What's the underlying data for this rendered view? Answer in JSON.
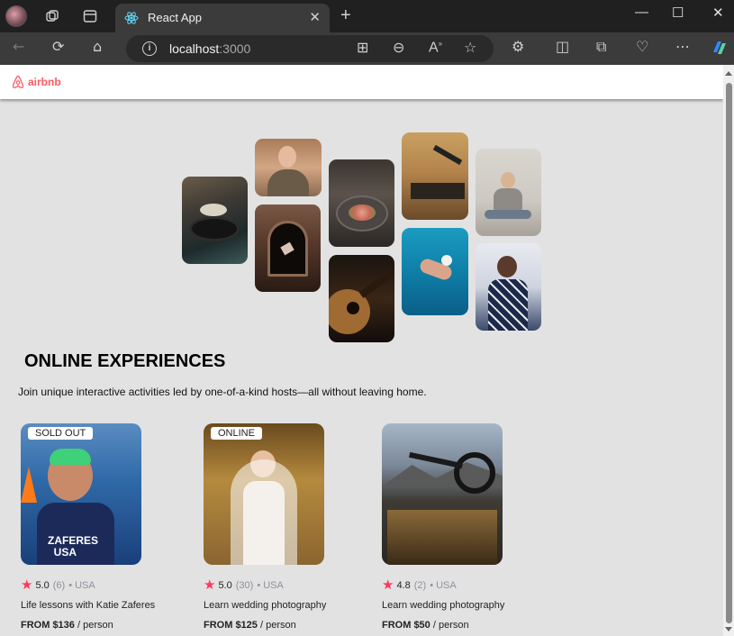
{
  "browser": {
    "tab_title": "React App",
    "address_host": "localhost",
    "address_port": ":3000"
  },
  "app": {
    "logo_text": "airbnb",
    "brand_color": "#ff5a5f",
    "section_title": "ONLINE EXPERIENCES",
    "section_description": "Join unique interactive activities led by one-of-a-kind hosts—all without leaving home.",
    "cards": [
      {
        "badge": "SOLD OUT",
        "score": "5.0",
        "reviews": "(6)",
        "location": "• USA",
        "title": "Life lessons with Katie Zaferes",
        "price": "FROM $136",
        "per": " / person"
      },
      {
        "badge": "ONLINE",
        "score": "5.0",
        "reviews": "(30)",
        "location": "• USA",
        "title": "Learn wedding photography",
        "price": "FROM $125",
        "per": " / person"
      },
      {
        "badge": "",
        "score": "4.8",
        "reviews": "(2)",
        "location": "• USA",
        "title": "Learn wedding photography",
        "price": "FROM $50",
        "per": " / person"
      }
    ]
  }
}
